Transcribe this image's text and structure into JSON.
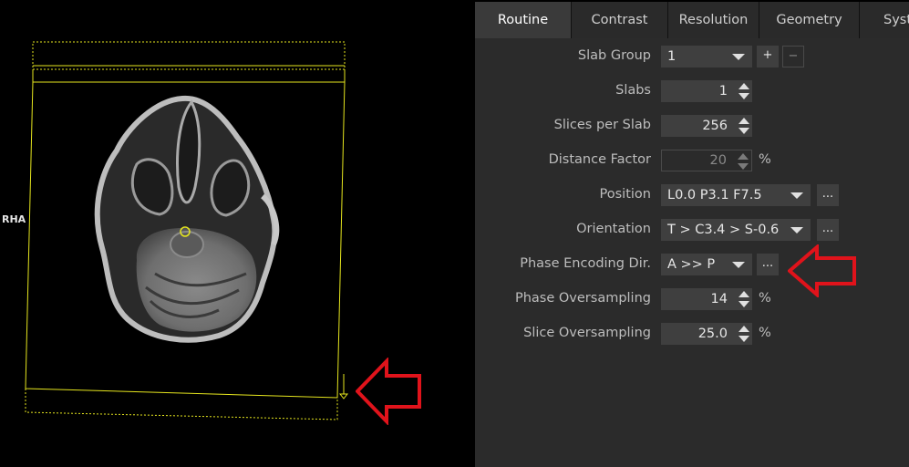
{
  "viewer": {
    "orientation_label": "RHA"
  },
  "tabs": [
    {
      "label": "Routine",
      "active": true
    },
    {
      "label": "Contrast",
      "active": false
    },
    {
      "label": "Resolution",
      "active": false
    },
    {
      "label": "Geometry",
      "active": false
    },
    {
      "label": "Syst",
      "active": false
    }
  ],
  "params": {
    "slab_group": {
      "label": "Slab Group",
      "value": "1",
      "add_label": "+",
      "remove_label": "−"
    },
    "slabs": {
      "label": "Slabs",
      "value": "1"
    },
    "slices_per_slab": {
      "label": "Slices per Slab",
      "value": "256"
    },
    "distance_factor": {
      "label": "Distance Factor",
      "value": "20",
      "unit": "%"
    },
    "position": {
      "label": "Position",
      "value": "L0.0 P3.1 F7.5",
      "more_label": "..."
    },
    "orientation": {
      "label": "Orientation",
      "value": "T > C3.4 > S-0.6",
      "more_label": "..."
    },
    "phase_encoding_dir": {
      "label": "Phase Encoding Dir.",
      "value": "A >> P",
      "more_label": "..."
    },
    "phase_oversampling": {
      "label": "Phase Oversampling",
      "value": "14",
      "unit": "%"
    },
    "slice_oversampling": {
      "label": "Slice Oversampling",
      "value": "25.0",
      "unit": "%"
    }
  },
  "colors": {
    "annotation_arrow": "#e0131b",
    "slab_outline": "#e6e61e",
    "panel_bg": "#2b2b2b",
    "field_bg": "#3f3f3f"
  }
}
